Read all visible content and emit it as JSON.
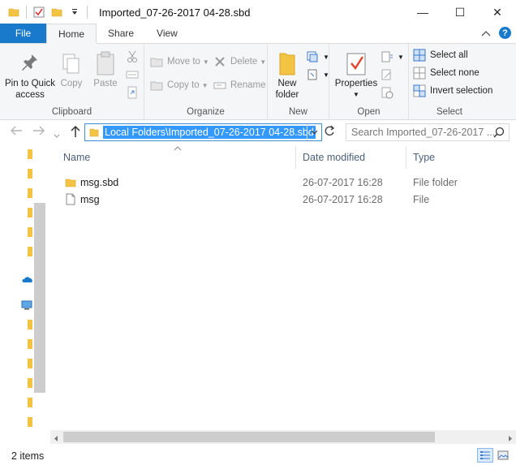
{
  "window": {
    "title": "Imported_07-26-2017 04-28.sbd",
    "minimize": "—",
    "maximize": "☐",
    "close": "✕"
  },
  "tabs": {
    "file": "File",
    "home": "Home",
    "share": "Share",
    "view": "View"
  },
  "ribbon": {
    "clipboard": {
      "label": "Clipboard",
      "pin": "Pin to Quick access",
      "copy": "Copy",
      "paste": "Paste"
    },
    "organize": {
      "label": "Organize",
      "move_to": "Move to",
      "copy_to": "Copy to",
      "delete": "Delete",
      "rename": "Rename"
    },
    "new": {
      "label": "New",
      "new_folder": "New folder"
    },
    "open": {
      "label": "Open",
      "properties": "Properties"
    },
    "select": {
      "label": "Select",
      "select_all": "Select all",
      "select_none": "Select none",
      "invert": "Invert selection"
    }
  },
  "address": {
    "path": "Local Folders\\Imported_07-26-2017 04-28.sbd",
    "search_placeholder": "Search Imported_07-26-2017 ..."
  },
  "columns": {
    "name": "Name",
    "date": "Date modified",
    "type": "Type"
  },
  "files": [
    {
      "name": "msg.sbd",
      "date": "26-07-2017 16:28",
      "type": "File folder",
      "icon": "folder-icon"
    },
    {
      "name": "msg",
      "date": "26-07-2017 16:28",
      "type": "File",
      "icon": "file-icon"
    }
  ],
  "status": {
    "items": "2 items"
  },
  "colors": {
    "accent": "#1979ca",
    "selection": "#3399ff",
    "folder": "#f3c444"
  }
}
